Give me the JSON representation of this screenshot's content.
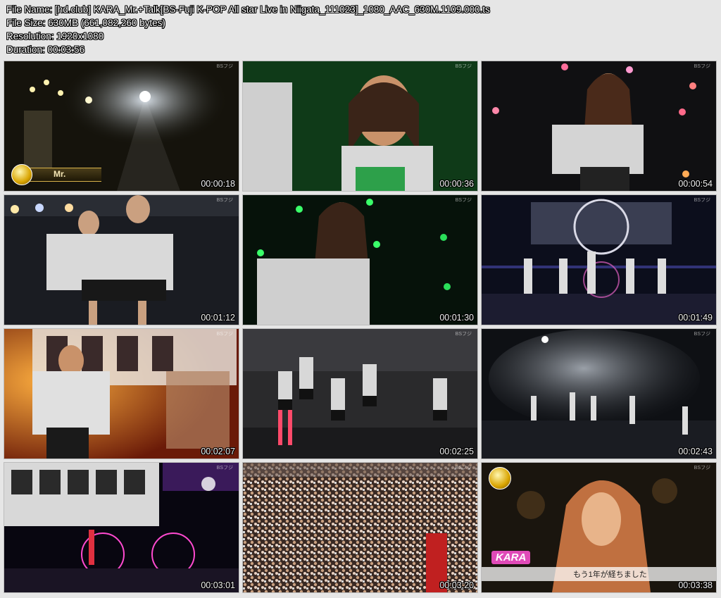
{
  "info": {
    "file_name": "File Name: [hd.club] KARA_Mr.+Talk[BS-Fuji K-POP All star Live in Niigata_111023]_1080_AAC_630M.1109.000.ts",
    "file_size": "File Size: 630MB (661,082,260 bytes)",
    "resolution": "Resolution: 1920x1080",
    "duration": "Duration: 00:03:56"
  },
  "channel_logo": "BSフジ",
  "badge_text": "Mr.",
  "subtitle": {
    "name": "KARA",
    "caption": "もう1年が経ちました"
  },
  "thumbnails": [
    {
      "timestamp": "00:00:18"
    },
    {
      "timestamp": "00:00:36"
    },
    {
      "timestamp": "00:00:54"
    },
    {
      "timestamp": "00:01:12"
    },
    {
      "timestamp": "00:01:30"
    },
    {
      "timestamp": "00:01:49"
    },
    {
      "timestamp": "00:02:07"
    },
    {
      "timestamp": "00:02:25"
    },
    {
      "timestamp": "00:02:43"
    },
    {
      "timestamp": "00:03:01"
    },
    {
      "timestamp": "00:03:20"
    },
    {
      "timestamp": "00:03:38"
    }
  ]
}
